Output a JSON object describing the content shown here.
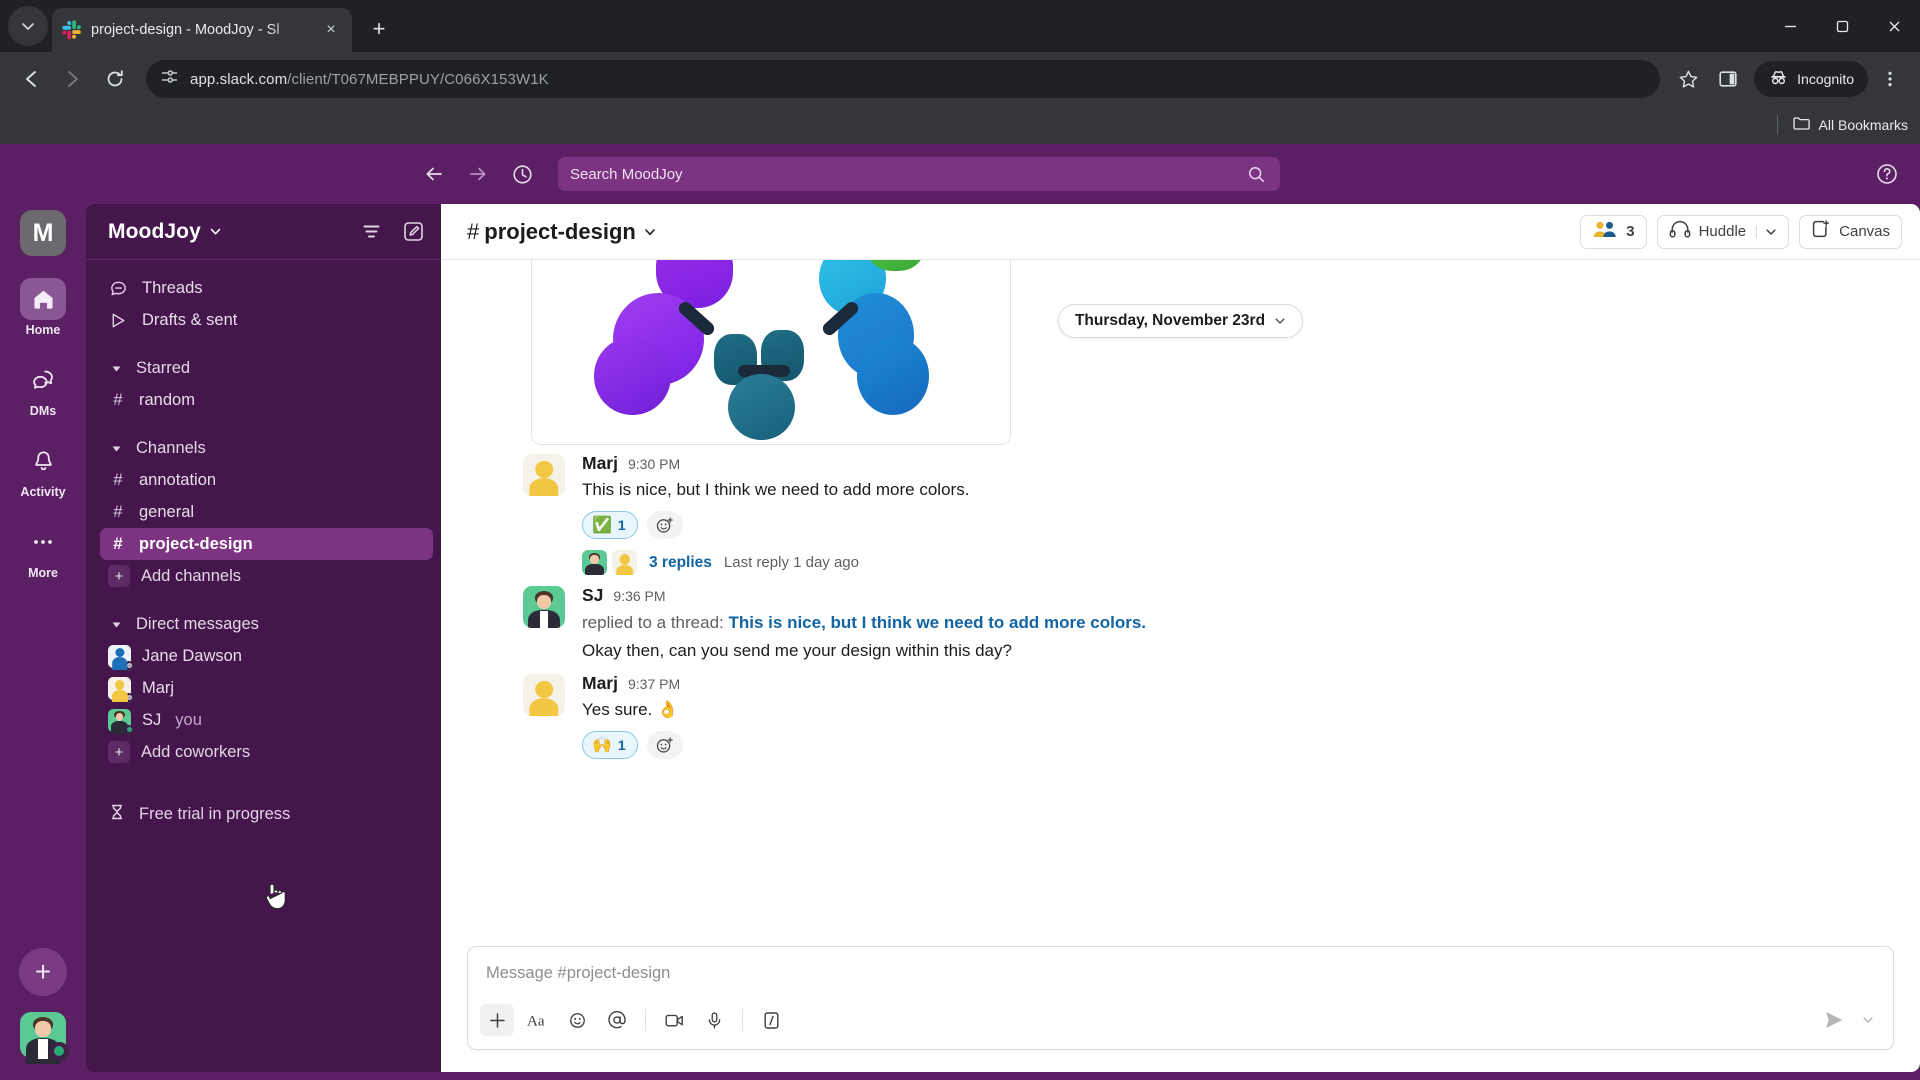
{
  "browser": {
    "tab_title": "project-design - MoodJoy - Sl",
    "url_host": "app.slack.com",
    "url_path": "/client/T067MEBPPUY/C066X153W1K",
    "incognito_label": "Incognito",
    "bookmarks_label": "All Bookmarks",
    "new_tab_label": "+",
    "close_tab_label": "×"
  },
  "slack": {
    "search_placeholder": "Search MoodJoy",
    "rail": {
      "workspace_initial": "M",
      "items": [
        {
          "label": "Home",
          "icon": "home-icon",
          "active": true
        },
        {
          "label": "DMs",
          "icon": "dms-icon",
          "active": false
        },
        {
          "label": "Activity",
          "icon": "bell-icon",
          "active": false
        },
        {
          "label": "More",
          "icon": "ellipsis-icon",
          "active": false
        }
      ],
      "new_label": "+"
    },
    "sidebar": {
      "workspace_name": "MoodJoy",
      "quick_items": [
        {
          "label": "Threads",
          "icon": "threads-icon"
        },
        {
          "label": "Drafts & sent",
          "icon": "drafts-icon"
        }
      ],
      "starred_section": "Starred",
      "starred_channels": [
        {
          "name": "random"
        }
      ],
      "channels_section": "Channels",
      "channels": [
        {
          "name": "annotation",
          "active": false
        },
        {
          "name": "general",
          "active": false
        },
        {
          "name": "project-design",
          "active": true
        }
      ],
      "add_channels_label": "Add channels",
      "dm_section": "Direct messages",
      "dms": [
        {
          "name": "Jane Dawson",
          "suffix": "",
          "avatar": "blue"
        },
        {
          "name": "Marj",
          "suffix": "",
          "avatar": "yellow"
        },
        {
          "name": "SJ",
          "suffix": "you",
          "avatar": "green"
        }
      ],
      "add_coworkers_label": "Add coworkers",
      "trial_label": "Free trial in progress"
    },
    "channel": {
      "name": "project-design",
      "member_count": "3",
      "huddle_label": "Huddle",
      "canvas_label": "Canvas",
      "date_divider": "Thursday, November 23rd"
    },
    "messages": [
      {
        "author": "Marj",
        "time": "9:30 PM",
        "avatar": "yellow",
        "text": "This is nice, but I think we need to add more colors.",
        "reaction": {
          "emoji": "✅",
          "count": "1"
        },
        "thread": {
          "replies": "3 replies",
          "last": "Last reply 1 day ago"
        }
      },
      {
        "author": "SJ",
        "time": "9:36 PM",
        "avatar": "green",
        "reply_prefix": "replied to a thread:",
        "reply_link": "This is nice, but I think we need to add more colors.",
        "text": "Okay then, can you send me your design within this day?"
      },
      {
        "author": "Marj",
        "time": "9:37 PM",
        "avatar": "yellow",
        "text": "Yes sure. 👌",
        "reaction": {
          "emoji": "🙌",
          "count": "1"
        }
      }
    ],
    "composer": {
      "placeholder": "Message #project-design",
      "tools": [
        "plus-icon",
        "text-format-icon",
        "emoji-icon",
        "mention-icon",
        "video-clip-icon",
        "audio-clip-icon",
        "slash-command-icon"
      ],
      "send_label": "send-icon"
    }
  },
  "colors": {
    "slack_aubergine": "#5b1f63",
    "sidebar_bg": "#45164c",
    "active_channel": "#7b3382",
    "link_blue": "#1264a3",
    "reaction_bg": "#e8f5fb"
  }
}
